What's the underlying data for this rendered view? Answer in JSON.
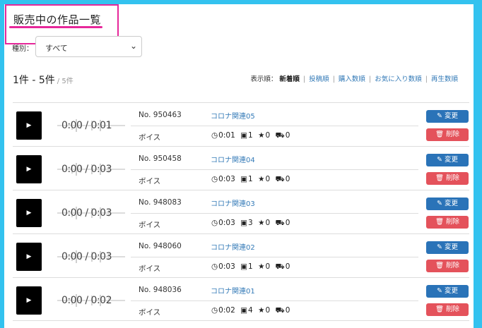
{
  "page": {
    "title": "販売中の作品一覧",
    "colors": {
      "accent_pink": "#e6279a",
      "edit_blue": "#2a73b8",
      "delete_red": "#e4525b",
      "link_blue": "#337ab7"
    }
  },
  "filter": {
    "label": "種別：",
    "selected": "すべて"
  },
  "summary": {
    "range": "1件 - 5件",
    "total": "/ 5件"
  },
  "sort": {
    "label": "表示順：",
    "options": [
      "新着順",
      "投稿順",
      "購入数順",
      "お気に入り数順",
      "再生数順"
    ],
    "active_index": 0
  },
  "items": [
    {
      "time": "0:00 / 0:01",
      "no": "No. 950463",
      "title": "コロナ関連05",
      "type": "ボイス",
      "duration": "0:01",
      "plays": "1",
      "stars": "0",
      "purchases": "0",
      "edit_label": "変更",
      "delete_label": "削除"
    },
    {
      "time": "0:00 / 0:03",
      "no": "No. 950458",
      "title": "コロナ関連04",
      "type": "ボイス",
      "duration": "0:03",
      "plays": "1",
      "stars": "0",
      "purchases": "0",
      "edit_label": "変更",
      "delete_label": "削除"
    },
    {
      "time": "0:00 / 0:03",
      "no": "No. 948083",
      "title": "コロナ関連03",
      "type": "ボイス",
      "duration": "0:03",
      "plays": "3",
      "stars": "0",
      "purchases": "0",
      "edit_label": "変更",
      "delete_label": "削除"
    },
    {
      "time": "0:00 / 0:03",
      "no": "No. 948060",
      "title": "コロナ関連02",
      "type": "ボイス",
      "duration": "0:03",
      "plays": "1",
      "stars": "0",
      "purchases": "0",
      "edit_label": "変更",
      "delete_label": "削除"
    },
    {
      "time": "0:00 / 0:02",
      "no": "No. 948036",
      "title": "コロナ関連01",
      "type": "ボイス",
      "duration": "0:02",
      "plays": "4",
      "stars": "0",
      "purchases": "0",
      "edit_label": "変更",
      "delete_label": "削除"
    }
  ],
  "icons": {
    "play": "play-icon",
    "clock": "clock-icon",
    "plays": "play-square-icon",
    "star": "star-icon",
    "cart": "cart-icon",
    "edit": "edit-icon",
    "trash": "trash-icon",
    "chevron": "chevron-down-icon"
  }
}
